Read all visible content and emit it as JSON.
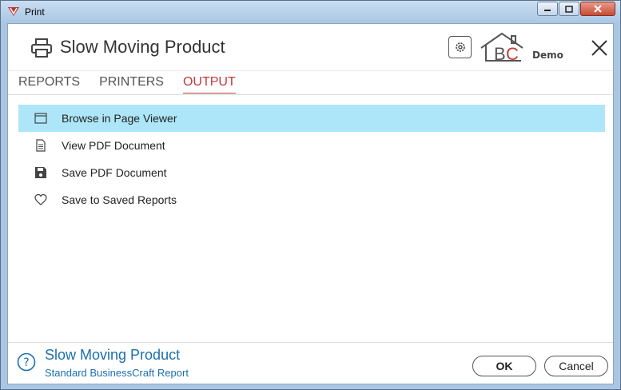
{
  "window": {
    "title": "Print"
  },
  "header": {
    "title": "Slow Moving Product",
    "demo_label": "Demo",
    "logo_text": "BC"
  },
  "tabs": [
    {
      "label": "REPORTS",
      "active": false
    },
    {
      "label": "PRINTERS",
      "active": false
    },
    {
      "label": "OUTPUT",
      "active": true
    }
  ],
  "output_options": [
    {
      "label": "Browse in Page Viewer",
      "icon": "window-icon",
      "selected": true
    },
    {
      "label": "View PDF Document",
      "icon": "document-icon",
      "selected": false
    },
    {
      "label": "Save PDF Document",
      "icon": "floppy-disk-icon",
      "selected": false
    },
    {
      "label": "Save to Saved Reports",
      "icon": "heart-icon",
      "selected": false
    }
  ],
  "footer": {
    "title": "Slow Moving Product",
    "subtitle": "Standard BusinessCraft Report",
    "ok_label": "OK",
    "cancel_label": "Cancel"
  },
  "colors": {
    "accent": "#c23a3a",
    "selection": "#aee6f9",
    "link": "#1a6fb0"
  }
}
